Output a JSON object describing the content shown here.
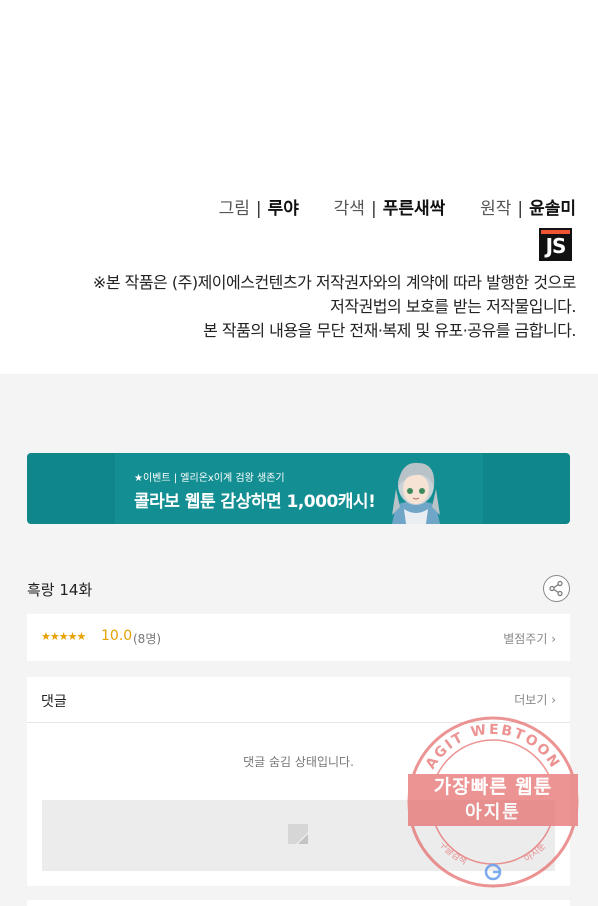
{
  "credits": {
    "drawing_role": "그림",
    "drawing_name": "루야",
    "adaptation_role": "각색",
    "adaptation_name": "푸른새싹",
    "original_role": "원작",
    "original_name": "윤솔미",
    "separator": "|",
    "publisher_logo_text": "JS",
    "copyright_lines": [
      "※본 작품은 (주)제이에스컨텐츠가 저작권자와의 계약에 따라 발행한 것으로",
      "저작권법의 보호를 받는 저작물입니다.",
      "본 작품의 내용을 무단 전재·복제 및 유포·공유를 금합니다."
    ]
  },
  "banner": {
    "subtitle": "★이벤트 | 엘리온x이계 검왕 생존기",
    "title": "콜라보 웹툰 감상하면 1,000캐시!"
  },
  "episode": {
    "title": "흑랑 14화",
    "share_icon": "share-icon"
  },
  "rating": {
    "stars": "★★★★★",
    "score": "10.0",
    "count": "(8명)",
    "rate_link": "별점주기 ›"
  },
  "comments": {
    "title": "댓글",
    "more_link": "더보기 ›",
    "hidden_message": "댓글 숨김 상태입니다.",
    "write_icon": "pencil-icon"
  },
  "watermark": {
    "arc_text": "AGIT WEBTOON",
    "line1": "가장빠른 웹툰",
    "line2": "아지툰",
    "bottom_left": "구글검색",
    "bottom_right": "아지툰"
  },
  "colors": {
    "banner_bg": "#0e868a",
    "star_color": "#e8a100",
    "stamp_red": "#e66a6a"
  }
}
